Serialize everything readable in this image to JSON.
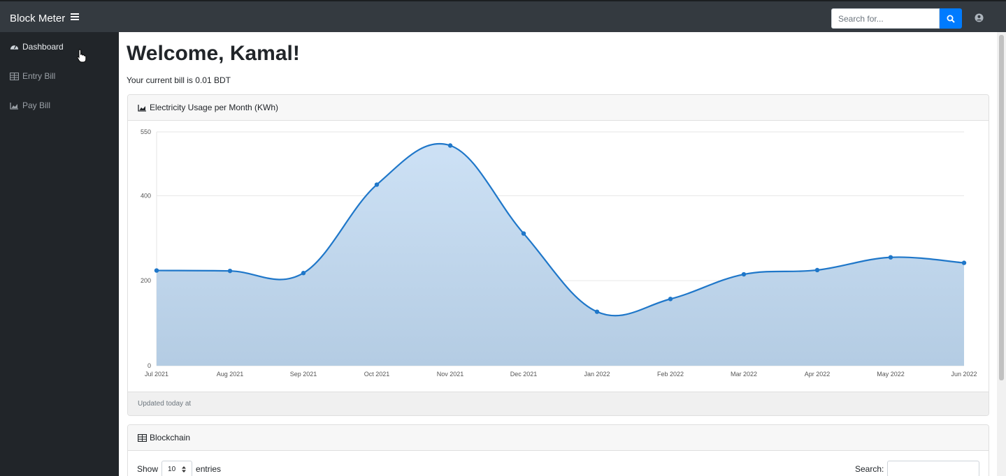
{
  "app": {
    "title": "Block Meter"
  },
  "search": {
    "placeholder": "Search for..."
  },
  "sidebar": {
    "items": [
      {
        "label": "Dashboard",
        "icon": "tachometer-icon"
      },
      {
        "label": "Entry Bill",
        "icon": "table-icon"
      },
      {
        "label": "Pay Bill",
        "icon": "chart-area-icon"
      }
    ]
  },
  "main": {
    "welcome": "Welcome, Kamal!",
    "bill_text": "Your current bill is 0.01 BDT"
  },
  "usage_card": {
    "title": "Electricity Usage per Month (KWh)",
    "footer": "Updated today at"
  },
  "blockchain_card": {
    "title": "Blockchain",
    "show_label": "Show",
    "entries_value": "10",
    "entries_label": "entries",
    "search_label": "Search:"
  },
  "colors": {
    "accent": "#007bff",
    "line": "#1f77c9",
    "fill": "#cfe2f6"
  },
  "chart_data": {
    "type": "area",
    "categories": [
      "Jul 2021",
      "Aug 2021",
      "Sep 2021",
      "Oct 2021",
      "Nov 2021",
      "Dec 2021",
      "Jan 2022",
      "Feb 2022",
      "Mar 2022",
      "Apr 2022",
      "May 2022",
      "Jun 2022"
    ],
    "series": [
      {
        "values": [
          224,
          223,
          218,
          426,
          518,
          311,
          127,
          157,
          215,
          225,
          255,
          242
        ]
      }
    ],
    "y_ticks": [
      0,
      200,
      400,
      550
    ],
    "ylim": [
      0,
      550
    ],
    "grid": true,
    "legend": "none"
  }
}
